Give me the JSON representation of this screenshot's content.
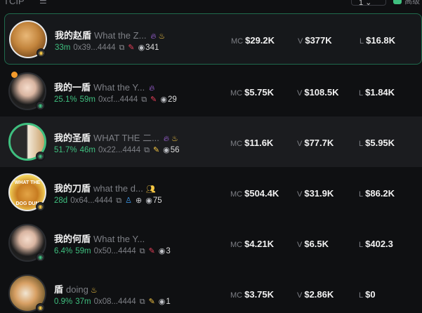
{
  "toolbar": {
    "tab_label": "TCIP",
    "count_value": "1",
    "checkbox_label": "高级"
  },
  "colors": {
    "accent_green": "#3fbf7f",
    "flame_purple": "#b06cf0",
    "gold": "#f6c744",
    "feather_red": "#e8405a",
    "person_blue": "#3d9bf0"
  },
  "tokens": [
    {
      "name_cn": "我的赵盾",
      "name_en": "What the Z...",
      "pct": "",
      "age": "33m",
      "address": "0x39...4444",
      "views": "341",
      "mc_label": "MC",
      "mc": "$29.2K",
      "v_label": "V",
      "v": "$377K",
      "l_label": "L",
      "l": "$16.8K",
      "icons": [
        "flame-icon",
        "chef-icon",
        "copy-icon",
        "feather-icon",
        "eye-icon"
      ]
    },
    {
      "name_cn": "我的一盾",
      "name_en": "What the Y...",
      "pct": "25.1%",
      "age": "59m",
      "address": "0xcf...4444",
      "views": "29",
      "mc_label": "MC",
      "mc": "$5.75K",
      "v_label": "V",
      "v": "$108.5K",
      "l_label": "L",
      "l": "$1.84K",
      "icons": [
        "flame-icon",
        "copy-icon",
        "feather-icon",
        "eye-icon"
      ]
    },
    {
      "name_cn": "我的圣盾",
      "name_en": "WHAT THE 二...",
      "pct": "51.7%",
      "age": "46m",
      "address": "0x22...4444",
      "views": "56",
      "mc_label": "MC",
      "mc": "$11.6K",
      "v_label": "V",
      "v": "$77.7K",
      "l_label": "L",
      "l": "$5.95K",
      "icons": [
        "flame-icon",
        "chef-icon",
        "copy-icon",
        "feather-icon",
        "eye-icon"
      ]
    },
    {
      "name_cn": "我的刀盾",
      "name_en": "what the d...",
      "pct": "",
      "age": "28d",
      "address": "0x64...4444",
      "views": "75",
      "mc_label": "MC",
      "mc": "$504.4K",
      "v_label": "V",
      "v": "$31.9K",
      "l_label": "L",
      "l": "$86.2K",
      "avatar_text_top": "WHAT THE",
      "avatar_text_bottom": "DOG DUN",
      "icons": [
        "people-icon",
        "copy-icon",
        "person-icon",
        "globe-icon",
        "eye-icon"
      ]
    },
    {
      "name_cn": "我的何盾",
      "name_en": "What the Y...",
      "pct": "6.4%",
      "age": "59m",
      "address": "0x50...4444",
      "views": "3",
      "mc_label": "MC",
      "mc": "$4.21K",
      "v_label": "V",
      "v": "$6.5K",
      "l_label": "L",
      "l": "$402.3",
      "icons": [
        "copy-icon",
        "feather-icon",
        "eye-icon"
      ]
    },
    {
      "name_cn": "盾",
      "name_en": "doing",
      "pct": "0.9%",
      "age": "37m",
      "address": "0x08...4444",
      "views": "1",
      "mc_label": "MC",
      "mc": "$3.75K",
      "v_label": "V",
      "v": "$2.86K",
      "l_label": "L",
      "l": "$0",
      "icons": [
        "chef-icon",
        "copy-icon",
        "feather-icon",
        "eye-icon"
      ]
    }
  ]
}
